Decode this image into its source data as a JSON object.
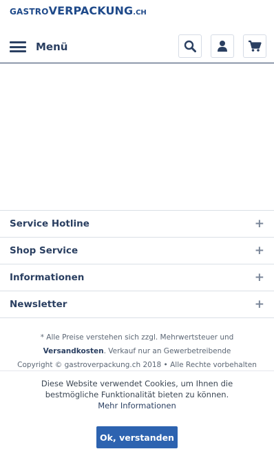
{
  "logo": {
    "part1": "GASTRO",
    "part2": "VERPACKUNG",
    "part3": ".CH"
  },
  "header": {
    "menu_label": "Menü",
    "icons": [
      "search-icon",
      "account-icon",
      "cart-icon"
    ]
  },
  "footer_nav": {
    "items": [
      {
        "label": "Service Hotline",
        "toggle": "+"
      },
      {
        "label": "Shop Service",
        "toggle": "+"
      },
      {
        "label": "Informationen",
        "toggle": "+"
      },
      {
        "label": "Newsletter",
        "toggle": "+"
      }
    ]
  },
  "legal": {
    "line1": "* Alle Preise verstehen sich zzgl. Mehrwertsteuer und",
    "shipping_link": "Versandkosten",
    "line2_rest": ". Verkauf nur an Gewerbetreibende",
    "copyright": "Copyright © gastroverpackung.ch 2018 • Alle Rechte vorbehalten"
  },
  "cookie": {
    "text_line1": "Diese Website verwendet Cookies, um Ihnen die",
    "text_line2": "bestmögliche Funktionalität bieten zu können.",
    "more_link": "Mehr Informationen",
    "accept_label": "Ok, verstanden"
  },
  "colors": {
    "brand": "#2a3f61",
    "logo": "#1f4a8a",
    "button": "#2d63b0"
  }
}
